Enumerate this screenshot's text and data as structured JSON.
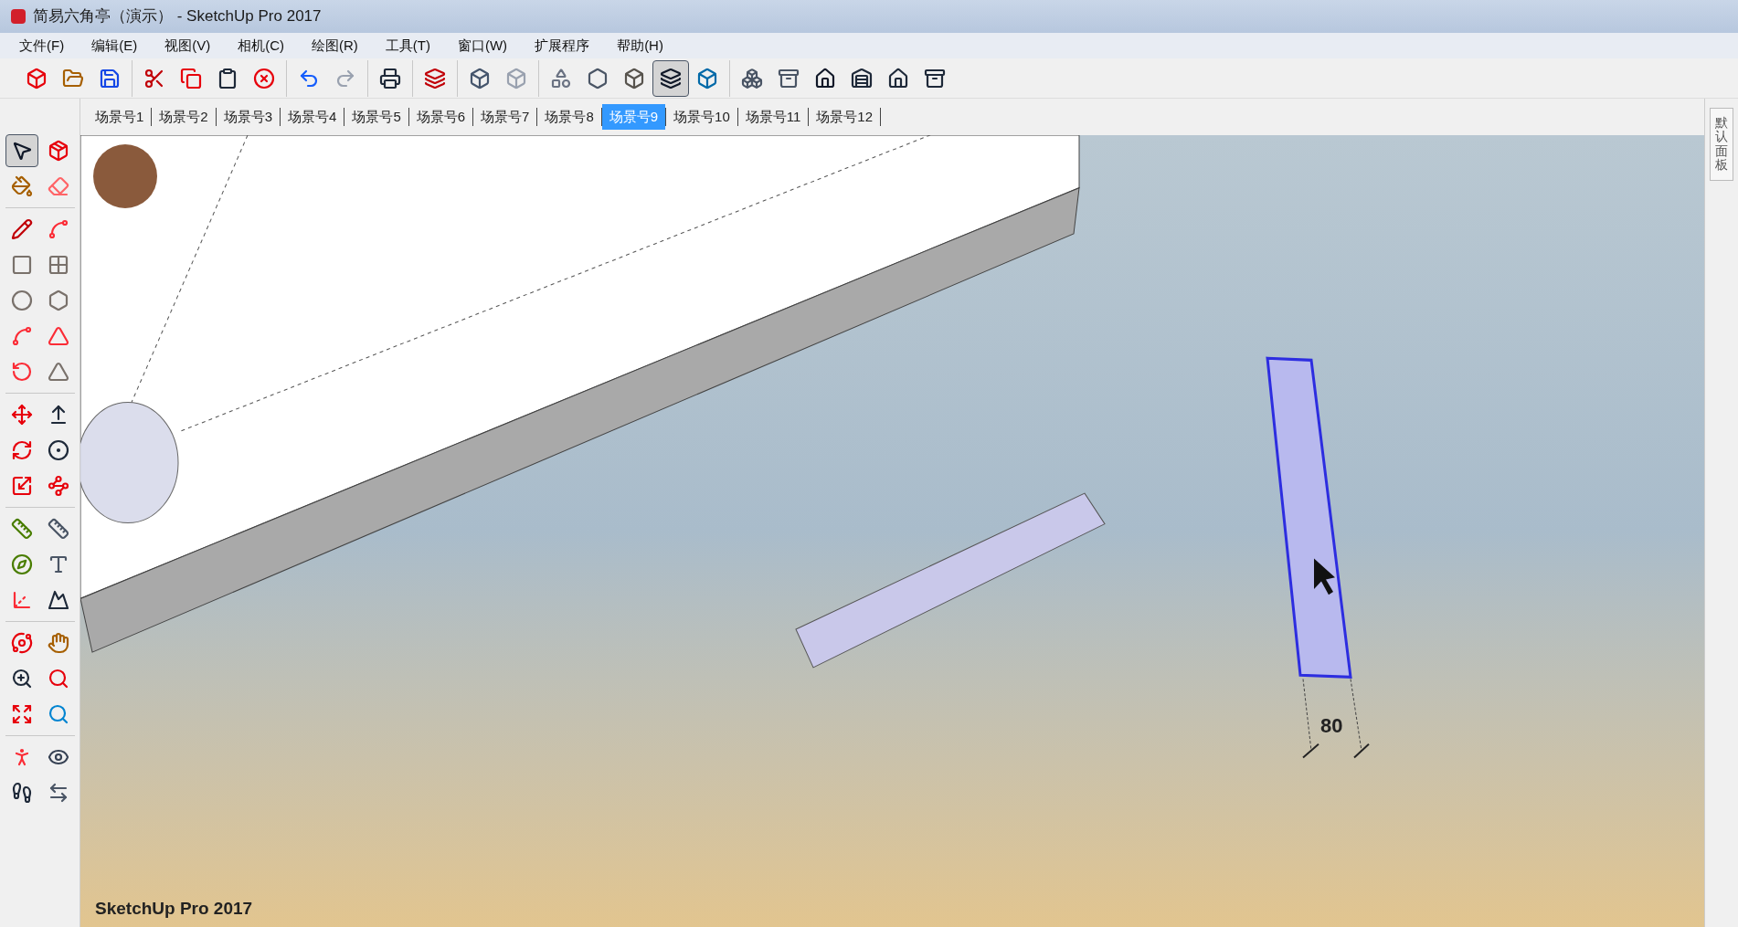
{
  "window": {
    "title": "简易六角亭（演示） - SketchUp Pro 2017"
  },
  "menu": [
    "文件(F)",
    "编辑(E)",
    "视图(V)",
    "相机(C)",
    "绘图(R)",
    "工具(T)",
    "窗口(W)",
    "扩展程序",
    "帮助(H)"
  ],
  "toolbar_groups": [
    [
      {
        "selected": false
      },
      {
        "selected": false
      },
      {
        "selected": false
      }
    ],
    [
      {
        "selected": false
      },
      {
        "selected": false
      },
      {
        "selected": false
      },
      {
        "selected": false
      }
    ],
    [
      {
        "selected": false
      },
      {
        "selected": false
      }
    ],
    [
      {
        "selected": false
      }
    ],
    [
      {
        "selected": false
      }
    ],
    [
      {
        "selected": false
      },
      {
        "selected": false
      }
    ],
    [
      {
        "selected": false
      },
      {
        "selected": false
      },
      {
        "selected": false
      },
      {
        "selected": true
      },
      {
        "selected": false
      }
    ],
    [
      {
        "selected": false
      },
      {
        "selected": false
      },
      {
        "selected": false
      },
      {
        "selected": false
      },
      {
        "selected": false
      },
      {
        "selected": false
      }
    ]
  ],
  "scene_tabs": [
    {
      "label": "场景号1",
      "selected": false
    },
    {
      "label": "场景号2",
      "selected": false
    },
    {
      "label": "场景号3",
      "selected": false
    },
    {
      "label": "场景号4",
      "selected": false
    },
    {
      "label": "场景号5",
      "selected": false
    },
    {
      "label": "场景号6",
      "selected": false
    },
    {
      "label": "场景号7",
      "selected": false
    },
    {
      "label": "场景号8",
      "selected": false
    },
    {
      "label": "场景号9",
      "selected": true
    },
    {
      "label": "场景号10",
      "selected": false
    },
    {
      "label": "场景号11",
      "selected": false
    },
    {
      "label": "场景号12",
      "selected": false
    }
  ],
  "tool_groups": [
    [
      {
        "selected": true
      },
      {
        "selected": false
      },
      {
        "selected": false
      },
      {
        "selected": false
      }
    ],
    [
      {
        "selected": false
      },
      {
        "selected": false
      },
      {
        "selected": false
      },
      {
        "selected": false
      },
      {
        "selected": false
      },
      {
        "selected": false
      },
      {
        "selected": false
      },
      {
        "selected": false
      },
      {
        "selected": false
      },
      {
        "selected": false
      }
    ],
    [
      {
        "selected": false
      },
      {
        "selected": false
      },
      {
        "selected": false
      },
      {
        "selected": false
      },
      {
        "selected": false
      },
      {
        "selected": false
      }
    ],
    [
      {
        "selected": false
      },
      {
        "selected": false
      },
      {
        "selected": false
      },
      {
        "selected": false
      },
      {
        "selected": false
      },
      {
        "selected": false
      }
    ],
    [
      {
        "selected": false
      },
      {
        "selected": false
      },
      {
        "selected": false
      },
      {
        "selected": false
      },
      {
        "selected": false
      },
      {
        "selected": false
      }
    ],
    [
      {
        "selected": false
      },
      {
        "selected": false
      },
      {
        "selected": false
      },
      {
        "selected": false
      }
    ]
  ],
  "viewport": {
    "dimension": "80",
    "edition_label": "SketchUp Pro 2017"
  },
  "side_panel": {
    "label": "默认面板"
  }
}
